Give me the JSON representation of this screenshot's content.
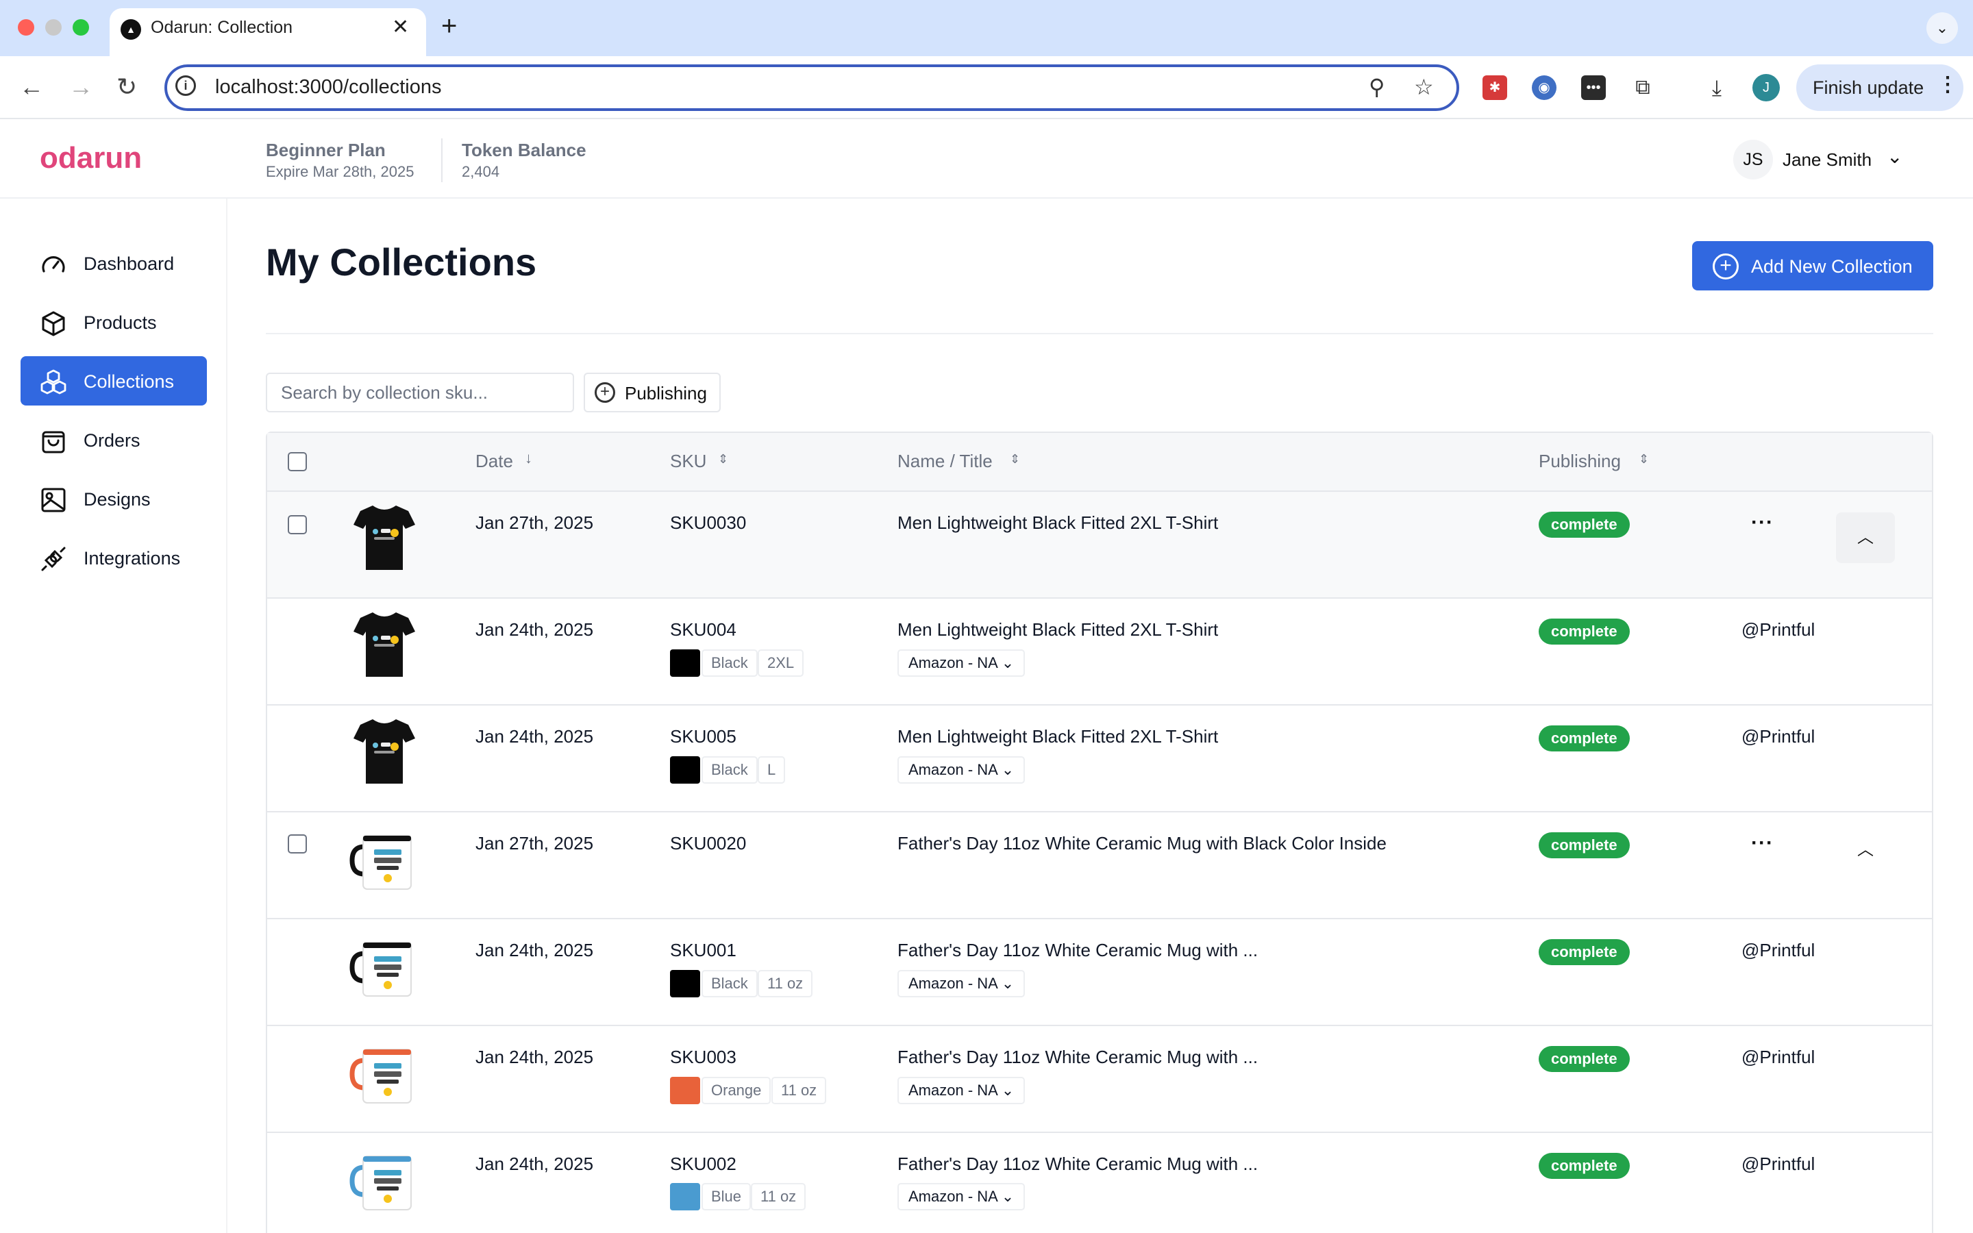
{
  "browser": {
    "tab_title": "Odarun: Collection",
    "url": "localhost:3000/collections",
    "finish_update": "Finish update",
    "profile_initial": "J"
  },
  "header": {
    "logo": "odarun",
    "plan_name": "Beginner Plan",
    "plan_expiry": "Expire Mar 28th, 2025",
    "token_label": "Token Balance",
    "token_value": "2,404",
    "user_initials": "JS",
    "user_name": "Jane Smith"
  },
  "sidebar": {
    "items": [
      {
        "label": "Dashboard",
        "icon": "gauge-icon"
      },
      {
        "label": "Products",
        "icon": "box-icon"
      },
      {
        "label": "Collections",
        "icon": "collections-icon",
        "active": true
      },
      {
        "label": "Orders",
        "icon": "shopping-bag-icon"
      },
      {
        "label": "Designs",
        "icon": "image-icon"
      },
      {
        "label": "Integrations",
        "icon": "plug-icon"
      }
    ]
  },
  "main": {
    "title": "My Collections",
    "add_button": "Add New Collection",
    "search_placeholder": "Search by collection sku...",
    "filter_label": "Publishing"
  },
  "table": {
    "headers": {
      "date": "Date",
      "sku": "SKU",
      "name": "Name / Title",
      "publishing": "Publishing"
    },
    "rows": [
      {
        "date": "Jan 27th, 2025",
        "sku": "SKU0030",
        "name": "Men Lightweight Black Fitted 2XL T-Shirt",
        "status": "complete",
        "product": "tshirt"
      },
      {
        "date": "Jan 24th, 2025",
        "sku": "SKU004",
        "color": "Black",
        "size": "2XL",
        "marketplace": "Amazon - NA",
        "name": "Men Lightweight Black Fitted 2XL T-Shirt",
        "status": "complete",
        "provider": "@Printful",
        "product": "tshirt"
      },
      {
        "date": "Jan 24th, 2025",
        "sku": "SKU005",
        "color": "Black",
        "size": "L",
        "marketplace": "Amazon - NA",
        "name": "Men Lightweight Black Fitted 2XL T-Shirt",
        "status": "complete",
        "provider": "@Printful",
        "product": "tshirt"
      },
      {
        "date": "Jan 27th, 2025",
        "sku": "SKU0020",
        "name": "Father's Day 11oz White Ceramic Mug with Black Color Inside",
        "status": "complete",
        "product": "mug"
      },
      {
        "date": "Jan 24th, 2025",
        "sku": "SKU001",
        "color": "Black",
        "size": "11 oz",
        "marketplace": "Amazon - NA",
        "name": "Father's Day 11oz White Ceramic Mug with ...",
        "status": "complete",
        "provider": "@Printful",
        "product": "mug"
      },
      {
        "date": "Jan 24th, 2025",
        "sku": "SKU003",
        "color": "Orange",
        "size": "11 oz",
        "marketplace": "Amazon - NA",
        "name": "Father's Day 11oz White Ceramic Mug with ...",
        "status": "complete",
        "provider": "@Printful",
        "product": "mug"
      },
      {
        "date": "Jan 24th, 2025",
        "sku": "SKU002",
        "color": "Blue",
        "size": "11 oz",
        "marketplace": "Amazon - NA",
        "name": "Father's Day 11oz White Ceramic Mug with ...",
        "status": "complete",
        "provider": "@Printful",
        "product": "mug"
      }
    ]
  },
  "colors": {
    "brand": "#e0457b",
    "accent": "#3168e0",
    "success": "#22a34a",
    "swatch_black": "#000000",
    "swatch_orange": "#e8623a",
    "swatch_blue": "#4a9bd0"
  }
}
